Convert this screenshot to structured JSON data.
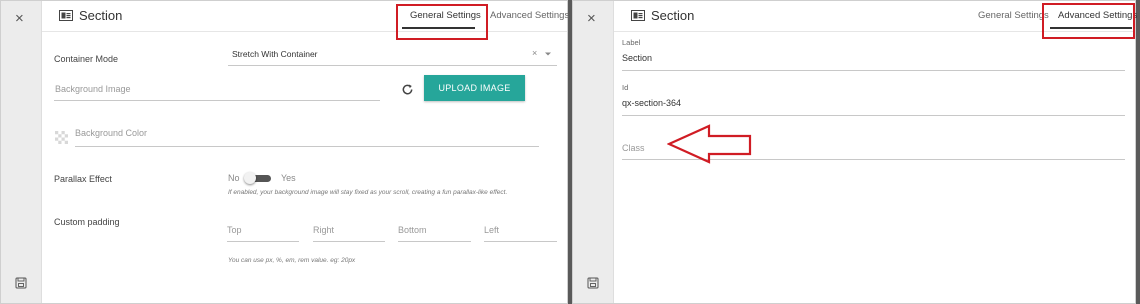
{
  "left_panel": {
    "close_glyph": "×",
    "title": "Section",
    "section_icon": "section-icon",
    "tabs": [
      "General Settings",
      "Advanced Settings"
    ],
    "active_tab": "General Settings",
    "container_mode": {
      "label": "Container Mode",
      "value": "Stretch With Container",
      "clear_glyph": "×"
    },
    "background_image": {
      "placeholder": "Background Image",
      "button_label": "UPLOAD IMAGE"
    },
    "background_color": {
      "placeholder": "Background Color"
    },
    "parallax": {
      "label": "Parallax Effect",
      "off_label": "No",
      "on_label": "Yes",
      "enabled": false,
      "help": "If enabled, your background image will stay fixed as your scroll, creating a fun parallax-like effect."
    },
    "custom_padding": {
      "label": "Custom padding",
      "fields": [
        "Top",
        "Right",
        "Bottom",
        "Left"
      ],
      "help": "You can use px, %, em, rem value. eg: 20px"
    }
  },
  "right_panel": {
    "close_glyph": "×",
    "title": "Section",
    "tabs": [
      "General Settings",
      "Advanced Settings"
    ],
    "active_tab": "Advanced Settings",
    "label_field": {
      "label": "Label",
      "value": "Section"
    },
    "id_field": {
      "label": "Id",
      "value": "qx-section-364"
    },
    "class_field": {
      "placeholder": "Class"
    }
  },
  "colors": {
    "accent_teal": "#26a69a",
    "highlight_red": "#d01c24",
    "sidebar_gray": "#ececec"
  }
}
